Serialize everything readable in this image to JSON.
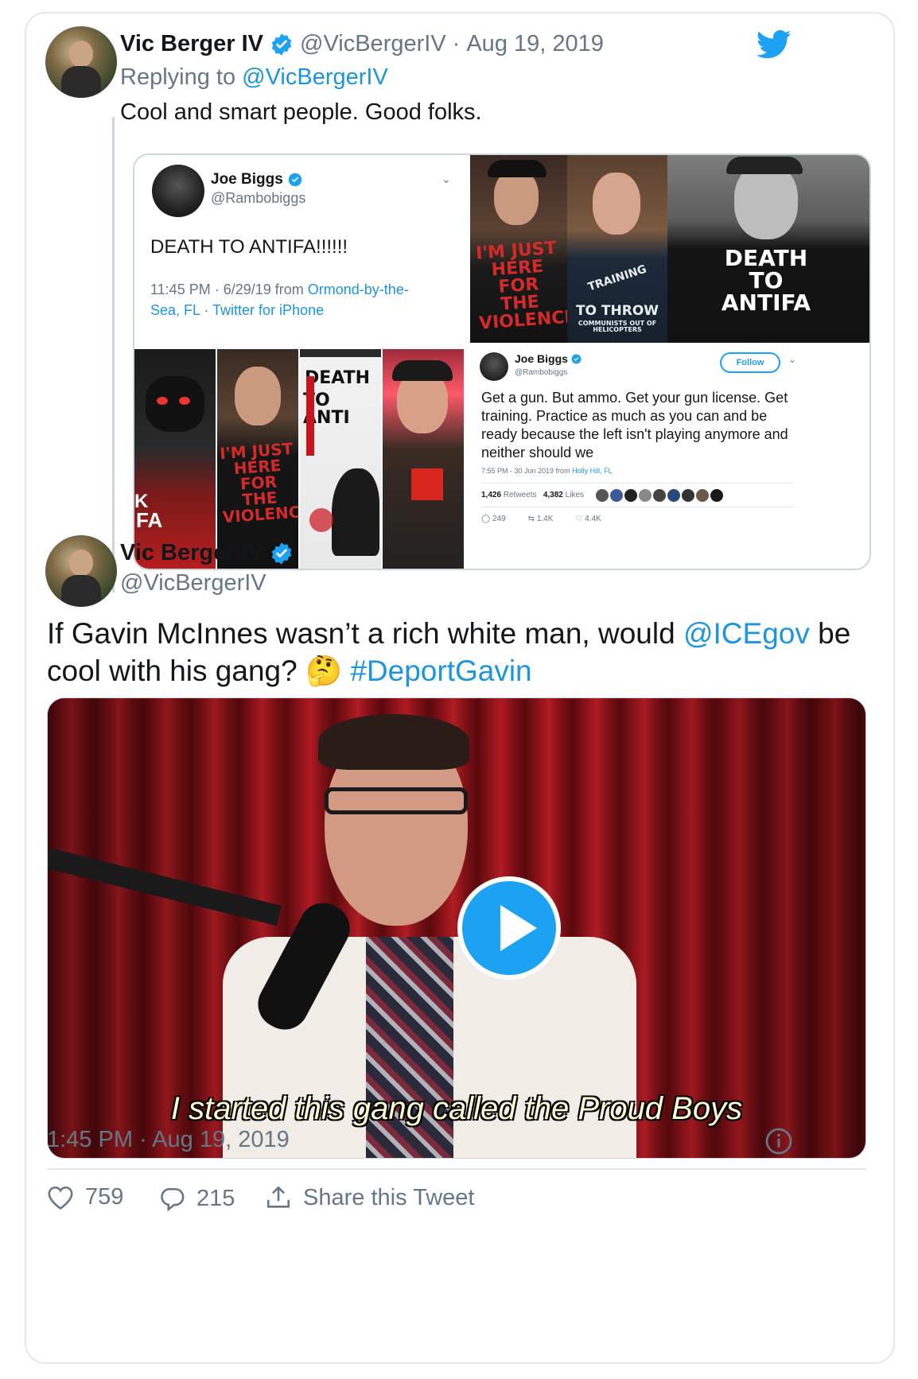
{
  "reply_tweet": {
    "author_name": "Vic Berger IV",
    "author_handle": "@VicBergerIV",
    "separator": "·",
    "date": "Aug 19, 2019",
    "replying_prefix": "Replying to",
    "replying_to": "@VicBergerIV",
    "text": "Cool and smart people. Good folks."
  },
  "embedded_tweet_1": {
    "author_name": "Joe Biggs",
    "author_handle": "@Rambobiggs",
    "text": "DEATH TO ANTIFA!!!!!!",
    "meta_prefix": "11:45 PM · 6/29/19 from",
    "location_line1": "Ormond-by-the-",
    "location_line2": "Sea, FL",
    "meta_sep": " · ",
    "client": "Twitter for iPhone"
  },
  "shirt_texts": {
    "shirt_1": "I'M JUST HERE FOR THE VIOLENCE",
    "shirt_2_top": "TRAINING",
    "shirt_2_mid": "TO THROW",
    "shirt_2_bottom": "COMMUNISTS OUT OF HELICOPTERS",
    "shirt_3": "DEATH TO ANTIFA",
    "shirt_4": "I'M JUST HERE FOR THE VIOLENCE",
    "poster_top": "DEATH",
    "poster_bottom": "TO ANTI",
    "flag_text": "FA",
    "flag_k": "K"
  },
  "embedded_tweet_2": {
    "author_name": "Joe Biggs",
    "author_handle": "@Rambobiggs",
    "follow_label": "Follow",
    "text": "Get a gun. But ammo. Get your gun license. Get training. Practice as much as you can and be ready because the left isn't playing anymore and neither should we",
    "meta_prefix": "7:55 PM - 30 Jun 2019 from",
    "location": "Holly Hill, FL",
    "retweets_count": "1,426",
    "retweets_label": "Retweets",
    "likes_count": "4,382",
    "likes_label": "Likes",
    "replies": "249",
    "retweets_short": "1.4K",
    "likes_short": "4.4K"
  },
  "main_tweet": {
    "author_name": "Vic Berger IV",
    "author_handle": "@VicBergerIV",
    "text_1": "If Gavin McInnes wasn’t a rich white man, would ",
    "mention": "@ICEgov",
    "text_2": " be",
    "text_3": "cool with his gang?",
    "emoji": "🤔",
    "hashtag": "#DeportGavin",
    "video_subtitle": "I started this gang called the Proud Boys",
    "timestamp": "1:45 PM · Aug 19, 2019",
    "likes": "759",
    "replies": "215",
    "share_label": "Share this Tweet"
  },
  "icons": {
    "brand": "twitter-bird-icon",
    "verified": "verified-badge-icon",
    "info": "info-icon",
    "like": "heart-icon",
    "reply": "reply-icon",
    "share": "share-icon",
    "play": "play-icon"
  },
  "colors": {
    "twitter_blue": "#1da1f2",
    "link_blue": "#1b95e0",
    "text": "#14171a",
    "muted": "#657786",
    "border": "#e1e8ed"
  }
}
